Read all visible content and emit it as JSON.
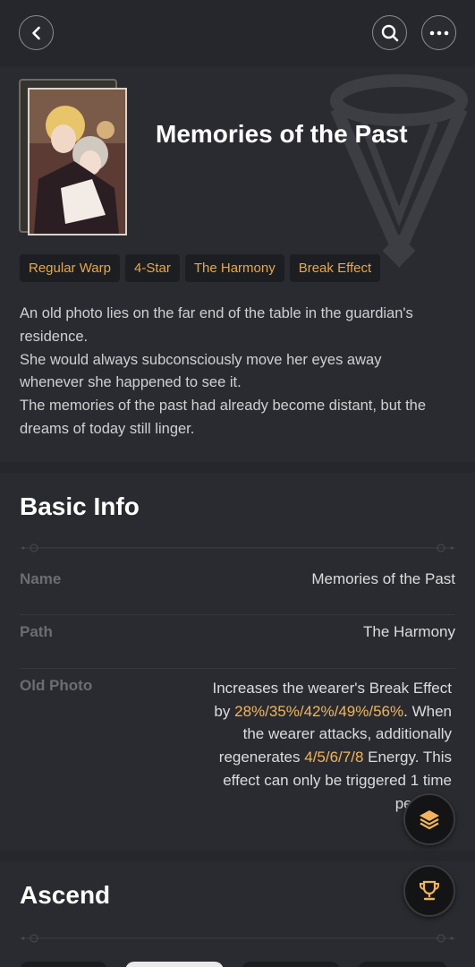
{
  "header": {
    "back_icon": "chevron-left-icon",
    "search_icon": "search-icon",
    "more_icon": "more-horizontal-icon"
  },
  "hero": {
    "title": "Memories of the Past",
    "tags": [
      "Regular Warp",
      "4-Star",
      "The Harmony",
      "Break Effect"
    ],
    "description": [
      "An old photo lies on the far end of the table in the guardian's residence.",
      "She would always subconsciously move her eyes away whenever she happened to see it.",
      "The memories of the past had already become distant, but the dreams of today still linger."
    ]
  },
  "basic_info": {
    "title": "Basic Info",
    "rows": [
      {
        "label": "Name",
        "value": "Memories of the Past"
      },
      {
        "label": "Path",
        "value": "The Harmony"
      }
    ],
    "effect": {
      "label": "Old Photo",
      "text_1": "Increases the wearer's Break Effect by ",
      "values_1": "28%/35%/42%/49%/56%",
      "text_2": ". When the wearer attacks, additionally regenerates ",
      "values_2": "4/5/6/7/8",
      "text_3": " Energy. This effect can only be triggered 1 time per turn."
    }
  },
  "ascend": {
    "title": "Ascend"
  },
  "fabs": {
    "layers_icon": "layers-icon",
    "trophy_icon": "trophy-icon"
  },
  "colors": {
    "accent": "#f0b55d",
    "tag_text": "#e7a74c",
    "background": "#26272c"
  }
}
